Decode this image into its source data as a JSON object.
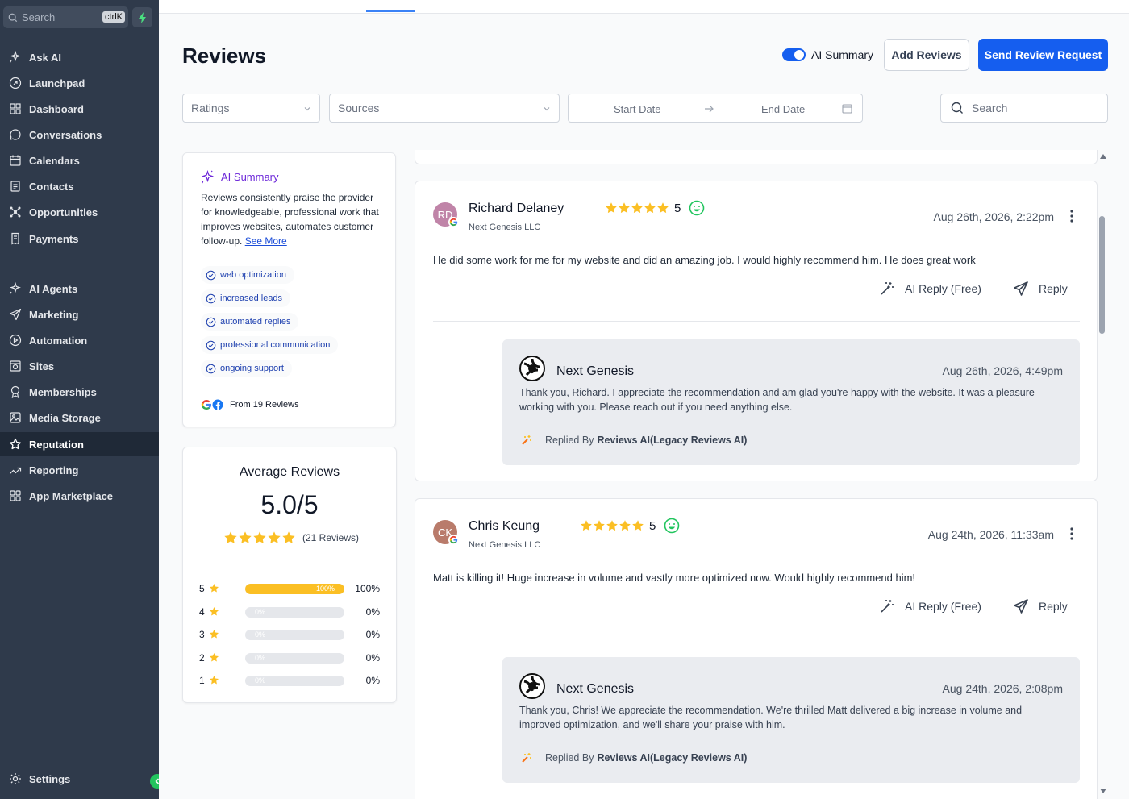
{
  "sidebar": {
    "search_placeholder": "Search",
    "search_shortcut": "ctrlK",
    "items": [
      {
        "label": "Ask AI",
        "icon": "sparkles-icon"
      },
      {
        "label": "Launchpad",
        "icon": "rocket-icon"
      },
      {
        "label": "Dashboard",
        "icon": "grid-icon"
      },
      {
        "label": "Conversations",
        "icon": "chat-bubble-icon"
      },
      {
        "label": "Calendars",
        "icon": "calendar-icon"
      },
      {
        "label": "Contacts",
        "icon": "contacts-icon"
      },
      {
        "label": "Opportunities",
        "icon": "network-icon"
      },
      {
        "label": "Payments",
        "icon": "receipt-icon"
      },
      {
        "label": "AI Agents",
        "icon": "sparkles-icon"
      },
      {
        "label": "Marketing",
        "icon": "send-icon"
      },
      {
        "label": "Automation",
        "icon": "gauge-icon"
      },
      {
        "label": "Sites",
        "icon": "globe-icon"
      },
      {
        "label": "Memberships",
        "icon": "award-icon"
      },
      {
        "label": "Media Storage",
        "icon": "image-icon"
      },
      {
        "label": "Reputation",
        "icon": "star-icon"
      },
      {
        "label": "Reporting",
        "icon": "trend-icon"
      },
      {
        "label": "App Marketplace",
        "icon": "apps-icon"
      }
    ],
    "settings_label": "Settings",
    "active": "Reputation"
  },
  "header": {
    "title": "Reviews",
    "ai_summary_toggle_label": "AI Summary",
    "ai_summary_enabled": true,
    "add_reviews_label": "Add Reviews",
    "send_request_label": "Send Review Request"
  },
  "filters": {
    "ratings_placeholder": "Ratings",
    "sources_placeholder": "Sources",
    "start_date_placeholder": "Start Date",
    "end_date_placeholder": "End Date",
    "search_placeholder": "Search"
  },
  "ai_summary": {
    "title": "AI Summary",
    "text": "Reviews consistently praise the provider for knowledgeable, professional work that improves websites, automates customer follow-up.",
    "see_more": "See More",
    "tags": [
      "web optimization",
      "increased leads",
      "automated replies",
      "professional communication",
      "ongoing support"
    ],
    "from": "From 19 Reviews"
  },
  "average": {
    "title": "Average Reviews",
    "score": "5.0/5",
    "count_label": "(21 Reviews)",
    "stars": 5,
    "distribution": [
      {
        "stars": "5",
        "percent": 100,
        "bar_label": "100%",
        "label": "100%"
      },
      {
        "stars": "4",
        "percent": 0,
        "bar_label": "0%",
        "label": "0%"
      },
      {
        "stars": "3",
        "percent": 0,
        "bar_label": "0%",
        "label": "0%"
      },
      {
        "stars": "2",
        "percent": 0,
        "bar_label": "0%",
        "label": "0%"
      },
      {
        "stars": "1",
        "percent": 0,
        "bar_label": "0%",
        "label": "0%"
      }
    ]
  },
  "reviews": [
    {
      "initials": "RD",
      "avatar_color": "#c084a8",
      "name": "Richard Delaney",
      "business": "Next Genesis LLC",
      "rating": "5",
      "date": "Aug 26th, 2026, 2:22pm",
      "text": "He did some work for me for my website and did an amazing job. I would highly recommend him. He does great work",
      "ai_reply_label": "AI Reply (Free)",
      "reply_label": "Reply",
      "response": {
        "name": "Next Genesis",
        "date": "Aug 26th, 2026, 4:49pm",
        "text": "Thank you, Richard. I appreciate the recommendation and am glad you're happy with the website. It was a pleasure working with you. Please reach out if you need anything else.",
        "replied_by_prefix": "Replied By",
        "replied_by": "Reviews AI(Legacy Reviews AI)"
      }
    },
    {
      "initials": "CK",
      "avatar_color": "#b97b6b",
      "name": "Chris Keung",
      "business": "Next Genesis LLC",
      "rating": "5",
      "date": "Aug 24th, 2026, 11:33am",
      "text": "Matt is killing it! Huge increase in volume and vastly more optimized now. Would highly recommend him!",
      "ai_reply_label": "AI Reply (Free)",
      "reply_label": "Reply",
      "response": {
        "name": "Next Genesis",
        "date": "Aug 24th, 2026, 2:08pm",
        "text": "Thank you, Chris! We appreciate the recommendation. We're thrilled Matt delivered a big increase in volume and improved optimization, and we'll share your praise with him.",
        "replied_by_prefix": "Replied By",
        "replied_by": "Reviews AI(Legacy Reviews AI)"
      }
    }
  ],
  "colors": {
    "sidebar_bg": "#2f3a4b",
    "primary": "#155eef",
    "star": "#fbbf24",
    "happy": "#22c55e"
  }
}
